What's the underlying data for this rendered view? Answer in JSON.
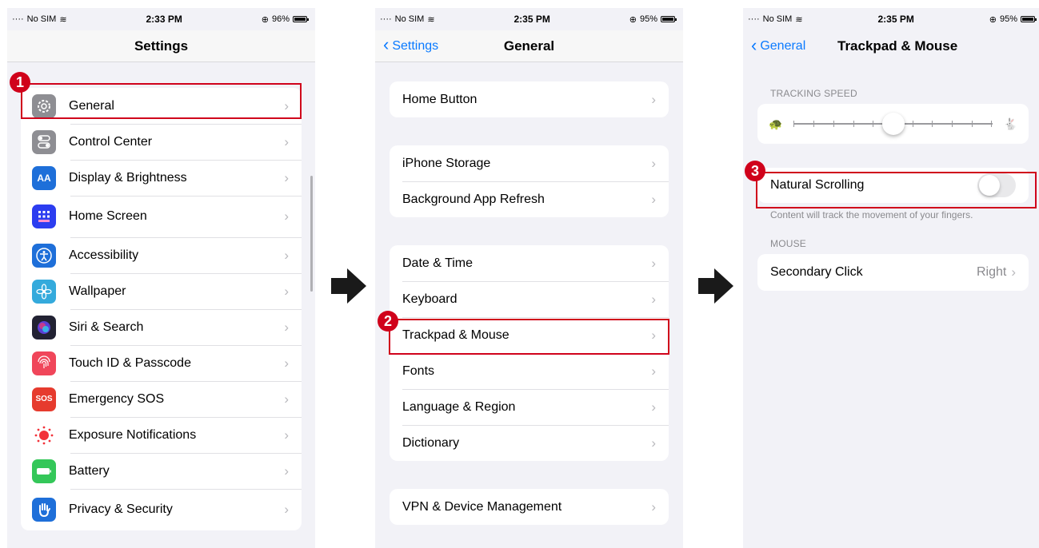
{
  "screen1": {
    "status": {
      "carrier": "No SIM",
      "time": "2:33 PM",
      "battery": "96%"
    },
    "title": "Settings",
    "items": [
      {
        "label": "General",
        "icon": "gear-icon",
        "color": "#8e8e93"
      },
      {
        "label": "Control Center",
        "icon": "toggles-icon",
        "color": "#8e8e93"
      },
      {
        "label": "Display & Brightness",
        "icon": "text-size-icon",
        "color": "#1e6fd9",
        "glyph": "AA"
      },
      {
        "label": "Home Screen",
        "icon": "grid-icon",
        "color": "#2c3df0"
      },
      {
        "label": "Accessibility",
        "icon": "accessibility-icon",
        "color": "#1e6fd9"
      },
      {
        "label": "Wallpaper",
        "icon": "flower-icon",
        "color": "#34aadc"
      },
      {
        "label": "Siri & Search",
        "icon": "siri-icon",
        "color": "#222233"
      },
      {
        "label": "Touch ID & Passcode",
        "icon": "fingerprint-icon",
        "color": "#f0465a"
      },
      {
        "label": "Emergency SOS",
        "icon": "sos-icon",
        "color": "#e63b2e",
        "glyph": "SOS"
      },
      {
        "label": "Exposure Notifications",
        "icon": "exposure-icon",
        "color": "#ffffff"
      },
      {
        "label": "Battery",
        "icon": "battery-icon",
        "color": "#34c759"
      },
      {
        "label": "Privacy & Security",
        "icon": "hand-icon",
        "color": "#1e6fd9"
      }
    ],
    "badge": "1"
  },
  "screen2": {
    "status": {
      "carrier": "No SIM",
      "time": "2:35 PM",
      "battery": "95%"
    },
    "back": "Settings",
    "title": "General",
    "groups": [
      [
        "Home Button"
      ],
      [
        "iPhone Storage",
        "Background App Refresh"
      ],
      [
        "Date & Time",
        "Keyboard",
        "Trackpad & Mouse",
        "Fonts",
        "Language & Region",
        "Dictionary"
      ],
      [
        "VPN & Device Management"
      ]
    ],
    "badge": "2"
  },
  "screen3": {
    "status": {
      "carrier": "No SIM",
      "time": "2:35 PM",
      "battery": "95%"
    },
    "back": "General",
    "title": "Trackpad & Mouse",
    "tracking_header": "TRACKING SPEED",
    "tracking_speed": 0.5,
    "natural_scrolling": {
      "label": "Natural Scrolling",
      "enabled": false
    },
    "natural_footer": "Content will track the movement of your fingers.",
    "mouse_header": "MOUSE",
    "secondary_click": {
      "label": "Secondary Click",
      "value": "Right"
    },
    "badge": "3"
  },
  "accent": "#0a7aff",
  "highlight_color": "#d0021b"
}
